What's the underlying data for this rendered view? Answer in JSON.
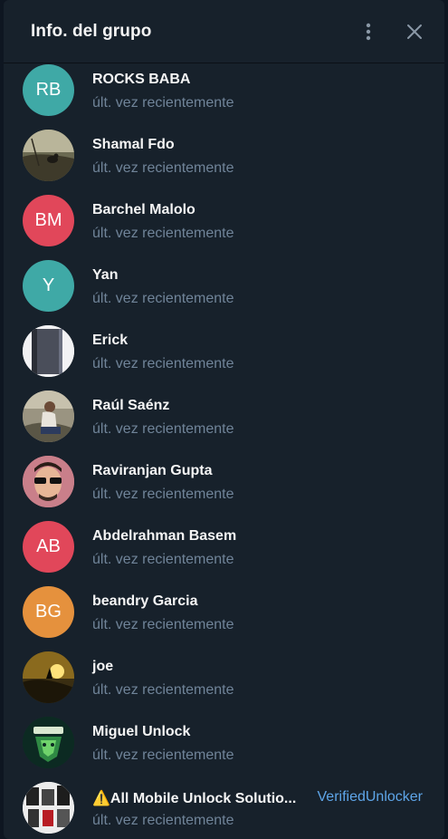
{
  "header": {
    "title": "Info. del grupo",
    "menu_icon": "more-vertical-icon",
    "close_icon": "close-icon"
  },
  "colors": {
    "panel_bg": "#17212b",
    "text_primary": "#f5f5f5",
    "text_secondary": "#708499",
    "accent": "#5ea5e8"
  },
  "members": [
    {
      "name": "ROCKS BABA",
      "status": "últ. vez recientemente",
      "initials": "RB",
      "avatar_color": "#3fa9a6"
    },
    {
      "name": "Shamal Fdo",
      "status": "últ. vez recientemente",
      "initials": "",
      "avatar_color": "#6d6a4e"
    },
    {
      "name": "Barchel Malolo",
      "status": "últ. vez recientemente",
      "initials": "BM",
      "avatar_color": "#e1475a"
    },
    {
      "name": "Yan",
      "status": "últ. vez recientemente",
      "initials": "Y",
      "avatar_color": "#3fa9a6"
    },
    {
      "name": "Erick",
      "status": "últ. vez recientemente",
      "initials": "",
      "avatar_color": "#d9d9dc"
    },
    {
      "name": "Raúl Saénz",
      "status": "últ. vez recientemente",
      "initials": "",
      "avatar_color": "#8b8576"
    },
    {
      "name": "Raviranjan Gupta",
      "status": "últ. vez recientemente",
      "initials": "",
      "avatar_color": "#d67a86"
    },
    {
      "name": "Abdelrahman Basem",
      "status": "últ. vez recientemente",
      "initials": "AB",
      "avatar_color": "#e1475a"
    },
    {
      "name": "beandry Garcia",
      "status": "últ. vez recientemente",
      "initials": "BG",
      "avatar_color": "#e5913d"
    },
    {
      "name": "joe",
      "status": "últ. vez recientemente",
      "initials": "",
      "avatar_color": "#5a4a1a"
    },
    {
      "name": "Miguel Unlock",
      "status": "últ. vez recientemente",
      "initials": "",
      "avatar_color": "#0f3a2c"
    },
    {
      "name": "⚠️All Mobile Unlock Solutio...",
      "status": "últ. vez recientemente",
      "initials": "",
      "avatar_color": "#e9e9e9",
      "badge": "VerifiedUnlocker"
    }
  ]
}
